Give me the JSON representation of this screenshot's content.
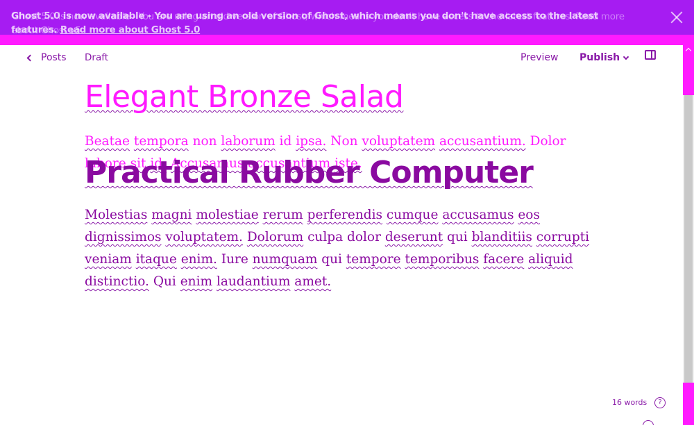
{
  "banner": {
    "title": "Ghost 5.0 is now available",
    "message": " - You are using an old version of Ghost, which means you don't have access to the latest features.",
    "link": "Read more about Ghost 5.0",
    "ghost_text": "Ghost 5.0 is now available - You are using an old version of Ghost, which means you don't have access to the latest features. Read more about Ghost v5"
  },
  "toolbar": {
    "back_label": "Posts",
    "status": "Draft",
    "preview": "Preview",
    "publish": "Publish"
  },
  "post": {
    "title": "Elegant Bronze Salad",
    "excerpt_words": [
      "Beatae",
      "tempora",
      "non",
      "laborum",
      "id",
      "ipsa.",
      "Non",
      "voluptatem",
      "accusantium.",
      "Dolor",
      "labore",
      "sit",
      "id.",
      "Accusamus",
      "accusantium",
      "iste."
    ],
    "overlay_heading": "Practical Rubber Computer",
    "body_words": [
      "Molestias",
      "magni",
      "molestiae",
      "rerum",
      "perferendis",
      "cumque",
      "accusamus",
      "eos",
      "dignissimos",
      "voluptatem.",
      "Dolorum",
      "culpa",
      "dolor",
      "deserunt",
      "qui",
      "blanditiis",
      "corrupti",
      "veniam",
      "itaque",
      "enim.",
      "Iure",
      "numquam",
      "qui",
      "tempore",
      "temporibus",
      "facere",
      "aliquid",
      "distinctio.",
      "Qui",
      "enim",
      "laudantium",
      "amet."
    ]
  },
  "footer": {
    "word_count": "16 words",
    "help": "?"
  },
  "colors": {
    "banner_bg": "#a61cf2",
    "accent_magenta": "#ff1aff",
    "text_purple": "#8a0aa0"
  }
}
